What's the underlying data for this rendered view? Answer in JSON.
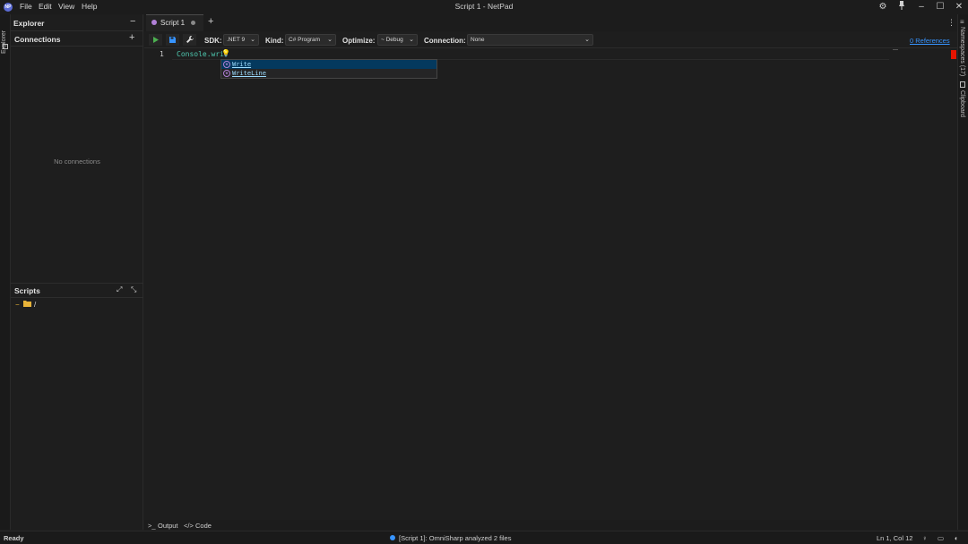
{
  "app": {
    "window_title": "Script 1 - NetPad",
    "logo_text": "NP",
    "menu": [
      "File",
      "Edit",
      "View",
      "Help"
    ]
  },
  "explorer": {
    "side_label": "Explorer",
    "title": "Explorer",
    "connections_title": "Connections",
    "connections_empty": "No connections",
    "scripts_title": "Scripts",
    "scripts_root": "/"
  },
  "tabs": [
    {
      "label": "Script 1",
      "active": true
    }
  ],
  "toolbar": {
    "sdk_label": "SDK:",
    "sdk_value": ".NET 9",
    "kind_label": "Kind:",
    "kind_value": "C# Program",
    "optimize_label": "Optimize:",
    "optimize_value": "Debug",
    "connection_label": "Connection:",
    "connection_value": "None",
    "references_link": "0 References"
  },
  "editor": {
    "line_number": "1",
    "code": "Console.wri",
    "suggestions": [
      "Write",
      "WriteLine"
    ]
  },
  "right_panel": {
    "namespaces": "Namespaces (17)",
    "clipboard": "Clipboard"
  },
  "bottom_tabs": {
    "output": "Output",
    "code": "Code"
  },
  "status": {
    "left": "Ready",
    "center": "[Script 1]: OmniSharp analyzed 2 files",
    "position": "Ln 1, Col 12"
  },
  "colors": {
    "accent": "#3794ff",
    "run_green": "#4caf50",
    "bookmark_red": "#e51400",
    "folder_yellow": "#e8b339"
  }
}
